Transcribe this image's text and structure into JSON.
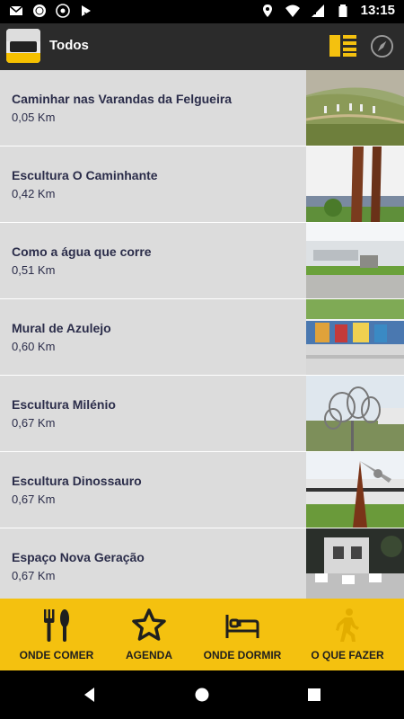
{
  "status_bar": {
    "time": "13:15",
    "left_icons": [
      "gmail-icon",
      "circle-app-icon",
      "camera-icon",
      "play-store-icon"
    ],
    "right_icons": [
      "location-icon",
      "wifi-icon",
      "signal-icon",
      "battery-icon"
    ]
  },
  "app_bar": {
    "title": "Todos",
    "logo_icon": "visit-coimbra-logo",
    "actions": [
      "list-view-icon",
      "compass-icon"
    ]
  },
  "items": [
    {
      "name": "Caminhar nas Varandas da Felgueira",
      "distance": "0,05 Km",
      "thumb": "hikers-on-hillside"
    },
    {
      "name": "Escultura O Caminhante",
      "distance": "0,42 Km",
      "thumb": "rust-steel-sculpture"
    },
    {
      "name": "Como a água que corre",
      "distance": "0,51 Km",
      "thumb": "white-building-lawn"
    },
    {
      "name": "Mural de Azulejo",
      "distance": "0,60 Km",
      "thumb": "tile-mural-wall"
    },
    {
      "name": "Escultura Milénio",
      "distance": "0,67 Km",
      "thumb": "metal-rings-sculpture"
    },
    {
      "name": "Escultura Dinossauro",
      "distance": "0,67 Km",
      "thumb": "dinosaur-sculpture"
    },
    {
      "name": "Espaço Nova Geração",
      "distance": "0,67 Km",
      "thumb": "terrace-white-chairs"
    }
  ],
  "bottom_nav": [
    {
      "label": "ONDE COMER",
      "icon": "fork-spoon-icon"
    },
    {
      "label": "AGENDA",
      "icon": "star-icon"
    },
    {
      "label": "ONDE DORMIR",
      "icon": "bed-icon"
    },
    {
      "label": "O QUE FAZER",
      "icon": "walking-person-icon"
    }
  ],
  "colors": {
    "accent": "#f4c10f",
    "app_bar": "#2b2b2b",
    "row_bg": "#dcdcdc",
    "text": "#2b2d4a"
  },
  "system_nav": [
    "back-icon",
    "home-icon",
    "recents-icon"
  ]
}
